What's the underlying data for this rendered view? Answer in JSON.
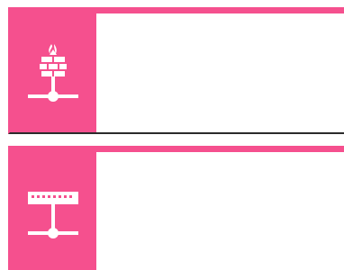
{
  "colors": {
    "accent": "#f5508e",
    "content_bg": "#ffffff",
    "icon": "#ffffff",
    "bottom_border": "#2b2b2b"
  },
  "tiles": [
    {
      "icon": "network-firewall-icon",
      "content": ""
    },
    {
      "icon": "network-switch-icon",
      "content": ""
    }
  ]
}
